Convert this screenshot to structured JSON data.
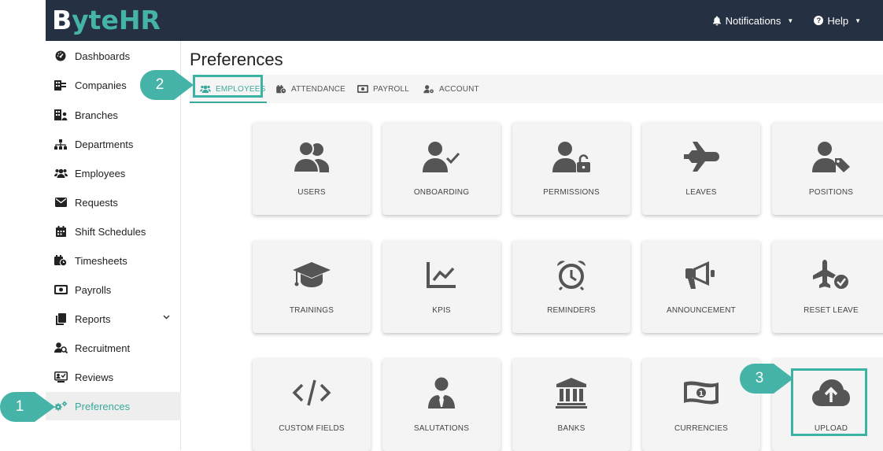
{
  "brand": {
    "logo_start": "B",
    "logo_y": "y",
    "logo_te": "te",
    "logo_hr": "HR"
  },
  "topbar": {
    "notifications_label": "Notifications",
    "help_label": "Help"
  },
  "sidebar": {
    "items": [
      {
        "label": "Dashboards",
        "icon": "tachometer-icon"
      },
      {
        "label": "Companies",
        "icon": "building-icon"
      },
      {
        "label": "Branches",
        "icon": "branch-building-icon"
      },
      {
        "label": "Departments",
        "icon": "sitemap-icon"
      },
      {
        "label": "Employees",
        "icon": "users-icon"
      },
      {
        "label": "Requests",
        "icon": "envelope-icon"
      },
      {
        "label": "Shift Schedules",
        "icon": "calendar-icon"
      },
      {
        "label": "Timesheets",
        "icon": "calendar-clock-icon"
      },
      {
        "label": "Payrolls",
        "icon": "money-bill-icon"
      },
      {
        "label": "Reports",
        "icon": "copy-icon"
      },
      {
        "label": "Recruitment",
        "icon": "user-search-icon"
      },
      {
        "label": "Reviews",
        "icon": "review-icon"
      },
      {
        "label": "Preferences",
        "icon": "cogs-icon"
      }
    ],
    "active_index": 12
  },
  "main": {
    "title": "Preferences",
    "tabs": [
      {
        "label": "EMPLOYEES",
        "icon": "users-icon"
      },
      {
        "label": "ATTENDANCE",
        "icon": "calendar-clock-icon"
      },
      {
        "label": "PAYROLL",
        "icon": "money-bill-icon"
      },
      {
        "label": "ACCOUNT",
        "icon": "user-cog-icon"
      }
    ],
    "active_tab": 0,
    "cards": [
      {
        "label": "USERS",
        "icon": "users-icon"
      },
      {
        "label": "ONBOARDING",
        "icon": "user-check-icon"
      },
      {
        "label": "PERMISSIONS",
        "icon": "user-lock-icon"
      },
      {
        "label": "LEAVES",
        "icon": "plane-icon"
      },
      {
        "label": "POSITIONS",
        "icon": "user-tag-icon"
      },
      {
        "label": "TRAININGS",
        "icon": "graduation-cap-icon"
      },
      {
        "label": "KPIS",
        "icon": "chart-line-icon"
      },
      {
        "label": "REMINDERS",
        "icon": "alarm-clock-icon"
      },
      {
        "label": "ANNOUNCEMENT",
        "icon": "bullhorn-icon"
      },
      {
        "label": "RESET LEAVE",
        "icon": "plane-check-icon"
      },
      {
        "label": "CUSTOM FIELDS",
        "icon": "code-icon"
      },
      {
        "label": "SALUTATIONS",
        "icon": "user-tie-icon"
      },
      {
        "label": "BANKS",
        "icon": "bank-icon"
      },
      {
        "label": "CURRENCIES",
        "icon": "money-bill-wave-icon"
      },
      {
        "label": "UPLOAD",
        "icon": "cloud-upload-icon"
      }
    ]
  },
  "callouts": [
    "1",
    "2",
    "3"
  ],
  "colors": {
    "topbar": "#253042",
    "accent": "#3aa99c",
    "callout": "#45b3a7",
    "icon_gray": "#555555"
  }
}
